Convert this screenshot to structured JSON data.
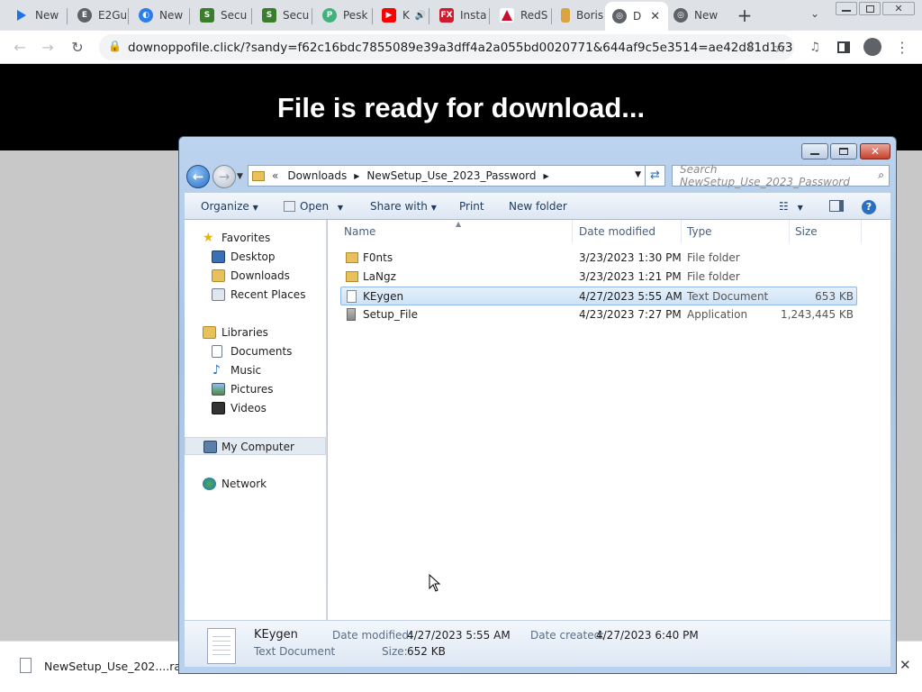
{
  "browser": {
    "tabs": [
      {
        "label": "New",
        "icon": "play-icon",
        "color": "#1a73e8"
      },
      {
        "label": "E2Gu",
        "icon": "e2-icon",
        "color": "#5f6368"
      },
      {
        "label": "New",
        "icon": "cloud-icon",
        "color": "#2b7de9"
      },
      {
        "label": "Secu",
        "icon": "shield-green-icon",
        "color": "#3a7d2c"
      },
      {
        "label": "Secu",
        "icon": "shield-green-icon",
        "color": "#3a7d2c"
      },
      {
        "label": "Pesk",
        "icon": "pesk-icon",
        "color": "#3db37a"
      },
      {
        "label": "K",
        "icon": "youtube-icon",
        "color": "#ff0000"
      },
      {
        "label": "Insta",
        "icon": "fx-icon",
        "color": "#d21a2e"
      },
      {
        "label": "RedS",
        "icon": "reds-icon",
        "color": "#c8102e"
      },
      {
        "label": "Boris",
        "icon": "boris-icon",
        "color": "#d9a441"
      },
      {
        "label": "D",
        "icon": "globe-icon",
        "color": "#5f6368"
      },
      {
        "label": "New",
        "icon": "chrome-icon",
        "color": "#5f6368"
      }
    ],
    "url": "downoppofile.click/?sandy=f62c16bdc7855089e39a3dff4a2a055bd0020771&644af9c5e3514=ae42d81d163..."
  },
  "page": {
    "banner_text": "File is ready for download..."
  },
  "download_bar": {
    "filename": "NewSetup_Use_202....rar"
  },
  "explorer": {
    "breadcrumb": [
      "Downloads",
      "NewSetup_Use_2023_Password"
    ],
    "breadcrumb_prefix": "«",
    "search_placeholder": "Search NewSetup_Use_2023_Password",
    "commands": {
      "organize": "Organize",
      "open": "Open",
      "share_with": "Share with",
      "print": "Print",
      "new_folder": "New folder"
    },
    "nav": {
      "favorites": "Favorites",
      "desktop": "Desktop",
      "downloads": "Downloads",
      "recent_places": "Recent Places",
      "libraries": "Libraries",
      "documents": "Documents",
      "music": "Music",
      "pictures": "Pictures",
      "videos": "Videos",
      "my_computer": "My Computer",
      "network": "Network"
    },
    "columns": {
      "name": "Name",
      "date_modified": "Date modified",
      "type": "Type",
      "size": "Size"
    },
    "files": [
      {
        "name": "F0nts",
        "date": "3/23/2023 1:30 PM",
        "type": "File folder",
        "size": "",
        "icon": "folder-icon"
      },
      {
        "name": "LaNgz",
        "date": "3/23/2023 1:21 PM",
        "type": "File folder",
        "size": "",
        "icon": "folder-icon"
      },
      {
        "name": "KEygen",
        "date": "4/27/2023 5:55 AM",
        "type": "Text Document",
        "size": "653 KB",
        "icon": "text-document-icon"
      },
      {
        "name": "Setup_File",
        "date": "4/23/2023 7:27 PM",
        "type": "Application",
        "size": "1,243,445 KB",
        "icon": "application-icon"
      }
    ],
    "details": {
      "name": "KEygen",
      "type": "Text Document",
      "date_modified_label": "Date modified:",
      "date_modified": "4/27/2023 5:55 AM",
      "size_label": "Size:",
      "size": "652 KB",
      "date_created_label": "Date created:",
      "date_created": "4/27/2023 6:40 PM"
    }
  }
}
